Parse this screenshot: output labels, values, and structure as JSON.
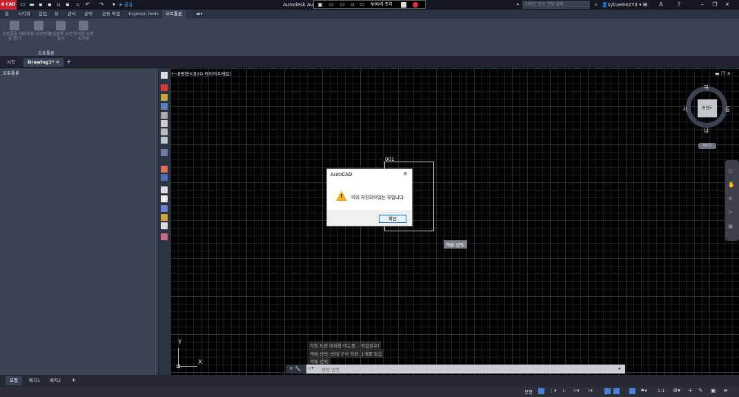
{
  "app": {
    "logo_text": "A CAD",
    "title": "Autodesk Aut",
    "notification": "99개 초과",
    "share": "공유",
    "search_placeholder": "키워드 또는 구절 입력",
    "user": "sybae84ZY4"
  },
  "ribbon_tabs": [
    "홈",
    "시각화",
    "삽입",
    "뷰",
    "관리",
    "출력",
    "공동 작업",
    "Express Tools",
    "오토툴론"
  ],
  "ribbon_buttons": [
    {
      "label": "오토툴론 대화창 열기"
    },
    {
      "label": "자동 도면번호"
    },
    {
      "label": "동일블록 도면찾기"
    },
    {
      "label": "인식된 도면 초기화"
    }
  ],
  "ribbon_group_label": "오토툴론",
  "doc_tabs": {
    "start": "시작",
    "drawing": "Drawing1*",
    "add": "+"
  },
  "left_panel": {
    "title": "오토툴론"
  },
  "viewport": {
    "label": "[−][평면도][2D 와이어프레임]",
    "rect_label": "001",
    "tooltip": "객체 선택:"
  },
  "viewcube": {
    "north": "북",
    "south": "남",
    "east": "동",
    "west": "서",
    "face": "평면도",
    "wcs": "WCS"
  },
  "dialog": {
    "title": "AutoCAD",
    "message": "이미 저장되어있는 뷰입니다.",
    "ok": "확인",
    "close": "✕"
  },
  "command_history": [
    "자동 도면 대화창 여는중... 작업완료!",
    "객체 선택: 반대 구석 지정: 1개를 찾음",
    "객체 선택:"
  ],
  "command": {
    "placeholder": "명령 입력"
  },
  "layout_tabs": [
    "모형",
    "배치1",
    "배치2"
  ],
  "status": {
    "model": "모형",
    "scale": "1:1"
  },
  "ucs": {
    "x": "X",
    "y": "Y"
  },
  "colors": {
    "accent": "#c8202e",
    "viewport_bg": "#000000",
    "panel": "#3c4454"
  }
}
